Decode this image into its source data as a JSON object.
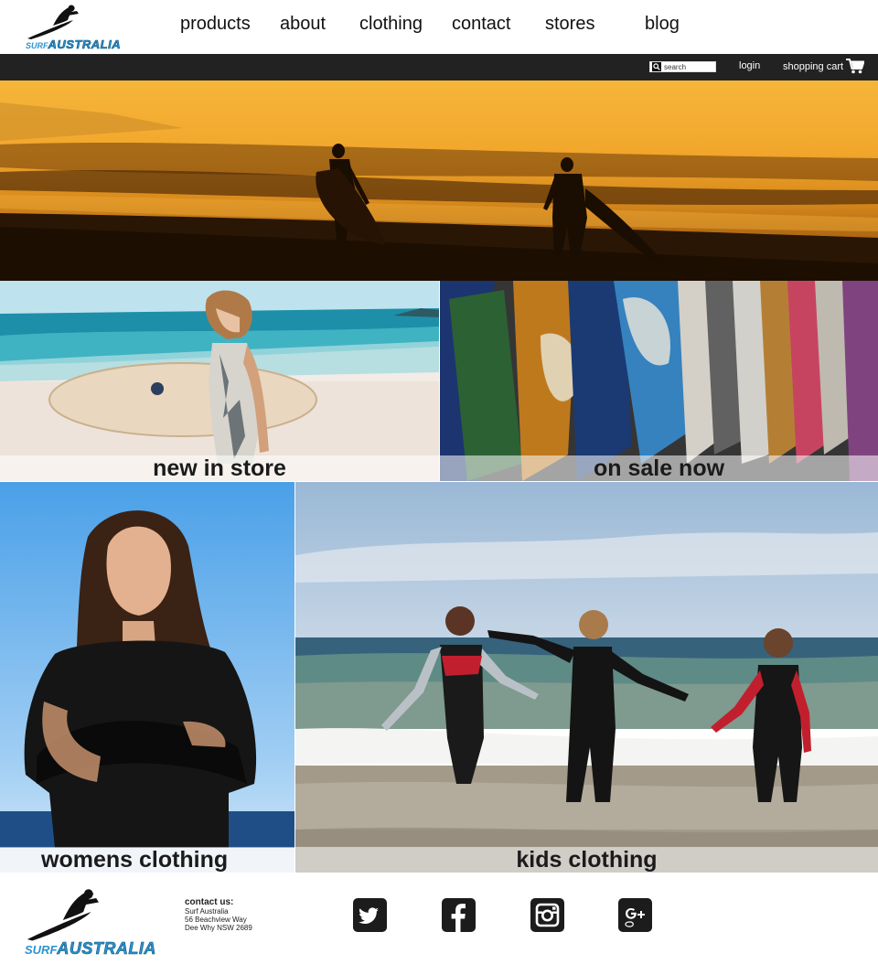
{
  "brand": {
    "logo_small": "SURF",
    "logo_big": "AUSTRALIA"
  },
  "nav": {
    "items": [
      {
        "label": "products"
      },
      {
        "label": "about"
      },
      {
        "label": "clothing"
      },
      {
        "label": "contact"
      },
      {
        "label": "stores"
      },
      {
        "label": "blog"
      }
    ]
  },
  "topbar": {
    "search_placeholder": "search",
    "login": "login",
    "cart": "shopping cart"
  },
  "tiles": {
    "new_in_store": "new in store",
    "on_sale_now": "on sale now",
    "womens_clothing": "womens clothing",
    "kids_clothing": "kids clothing"
  },
  "footer": {
    "contact_title": "contact us:",
    "address_lines": [
      "Surf Australia",
      "56 Beachview Way",
      "Dee Why NSW 2689"
    ],
    "social": [
      {
        "icon": "twitter-icon"
      },
      {
        "icon": "facebook-icon"
      },
      {
        "icon": "instagram-icon"
      },
      {
        "icon": "google-plus-icon"
      }
    ]
  },
  "colors": {
    "topbar": "#222222",
    "logo_blue": "#2a95d0",
    "icon_dark": "#1c1c1c"
  }
}
